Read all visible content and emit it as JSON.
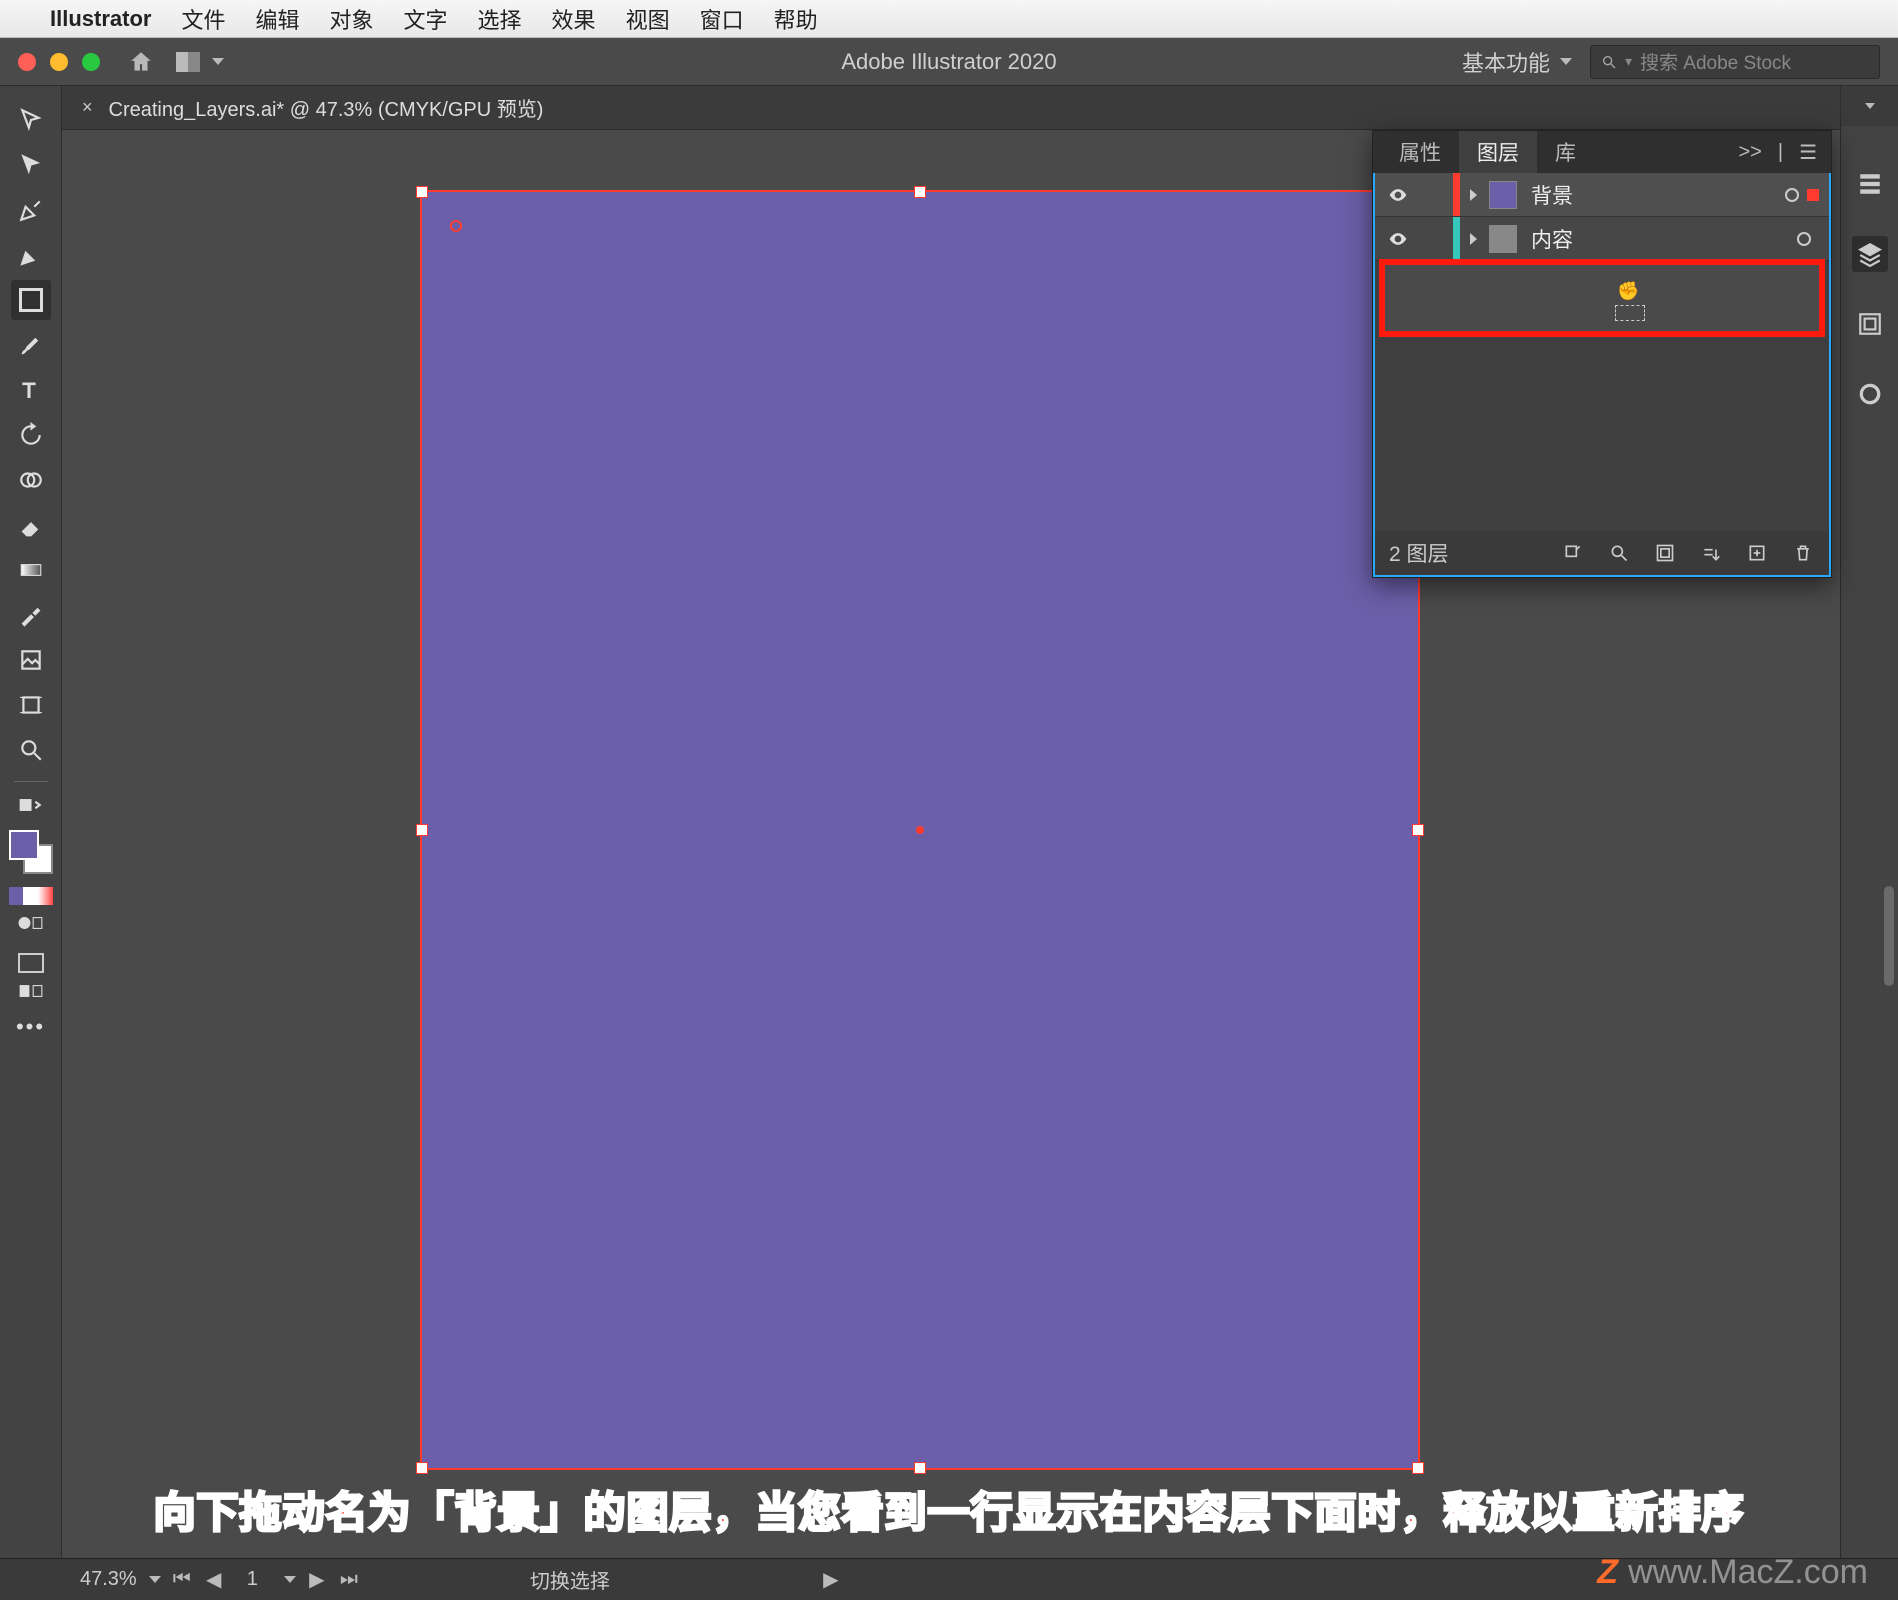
{
  "menubar": {
    "app": "Illustrator",
    "items": [
      "文件",
      "编辑",
      "对象",
      "文字",
      "选择",
      "效果",
      "视图",
      "窗口",
      "帮助"
    ]
  },
  "appbar": {
    "title": "Adobe Illustrator 2020",
    "workspace": "基本功能",
    "search_placeholder": "搜索 Adobe Stock"
  },
  "document": {
    "tab_title": "Creating_Layers.ai* @ 47.3% (CMYK/GPU 预览)"
  },
  "layers_panel": {
    "tabs": {
      "properties": "属性",
      "layers": "图层",
      "libraries": "库"
    },
    "expand_label": ">>",
    "rows": [
      {
        "name": "背景",
        "colorbar": "cb-red",
        "thumb": "solid",
        "selected": true
      },
      {
        "name": "内容",
        "colorbar": "cb-teal",
        "thumb": "img",
        "selected": false
      }
    ],
    "footer_count": "2 图层"
  },
  "statusbar": {
    "zoom": "47.3%",
    "artboard_num": "1",
    "tool_label": "切换选择"
  },
  "caption": "向下拖动名为「背景」的图层，当您看到一行显示在内容层下面时，释放以重新排序",
  "watermark": {
    "z": "Z",
    "text": "www.MacZ.com"
  },
  "colors": {
    "artwork": "#6a5fa8",
    "highlight": "#ff1a0e"
  }
}
